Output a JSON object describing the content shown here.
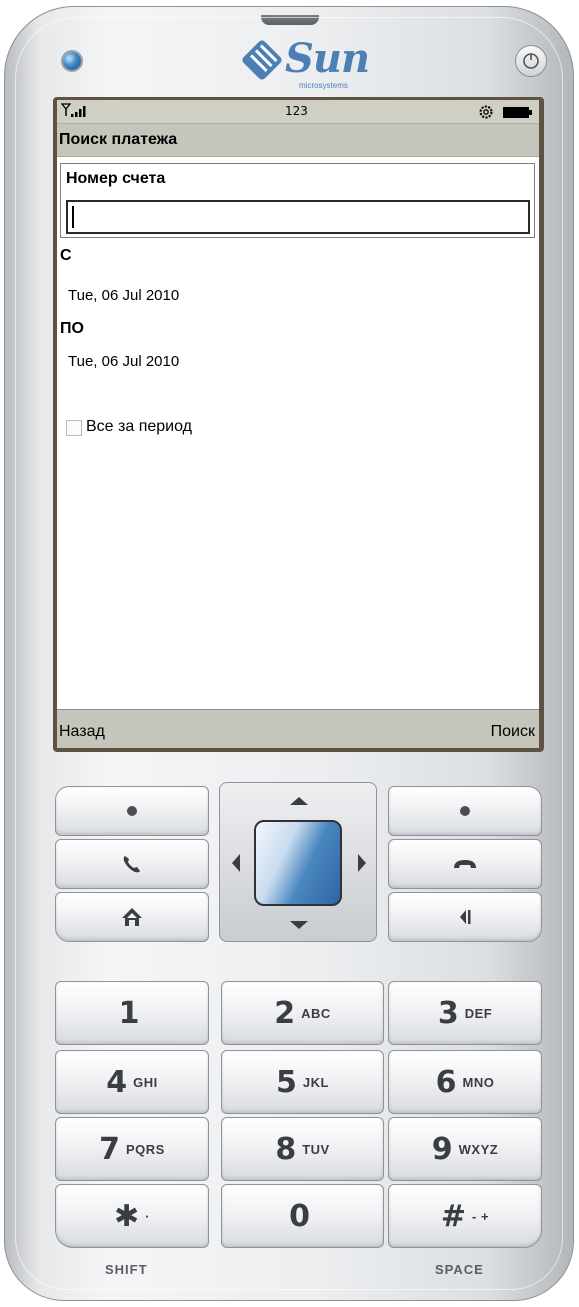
{
  "phone": {
    "brand": "Sun",
    "brand_sub": "microsystems"
  },
  "status_bar": {
    "center_text": "123"
  },
  "screen": {
    "title": "Поиск платежа",
    "account_label": "Номер счета",
    "account_value": "",
    "from_label": "С",
    "from_value": "Tue, 06 Jul 2010",
    "to_label": "ПО",
    "to_value": "Tue, 06 Jul 2010",
    "checkbox_label": "Все за период",
    "checkbox_checked": false
  },
  "softkeys": {
    "left": "Назад",
    "right": "Поиск"
  },
  "keypad": {
    "keys": [
      {
        "main": "1",
        "sub": ""
      },
      {
        "main": "2",
        "sub": "ABC"
      },
      {
        "main": "3",
        "sub": "DEF"
      },
      {
        "main": "4",
        "sub": "GHI"
      },
      {
        "main": "5",
        "sub": "JKL"
      },
      {
        "main": "6",
        "sub": "MNO"
      },
      {
        "main": "7",
        "sub": "PQRS"
      },
      {
        "main": "8",
        "sub": "TUV"
      },
      {
        "main": "9",
        "sub": "WXYZ"
      },
      {
        "main": "✱",
        "sub": "·"
      },
      {
        "main": "0",
        "sub": ""
      },
      {
        "main": "#",
        "sub": "- +"
      }
    ],
    "shift_label": "SHIFT",
    "space_label": "SPACE"
  }
}
